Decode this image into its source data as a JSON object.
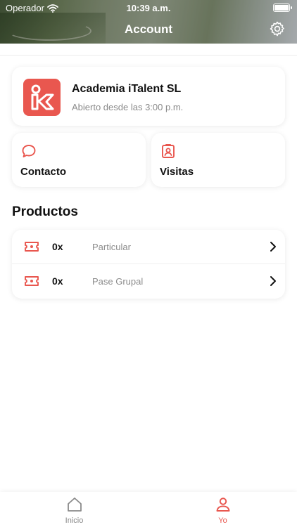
{
  "status_bar": {
    "carrier": "Operador",
    "time": "10:39 a.m."
  },
  "header": {
    "title": "Account",
    "settings_icon": "gear-icon"
  },
  "business": {
    "name": "Academia iTalent SL",
    "status": "Abierto desde las 3:00 p.m.",
    "logo_color": "#e9574f"
  },
  "tiles": {
    "contact": {
      "label": "Contacto",
      "icon": "chat-bubble-icon"
    },
    "visits": {
      "label": "Visitas",
      "icon": "id-badge-icon"
    }
  },
  "products": {
    "title": "Productos",
    "items": [
      {
        "qty": "0x",
        "name": "Particular",
        "icon": "ticket-icon"
      },
      {
        "qty": "0x",
        "name": "Pase Grupal",
        "icon": "ticket-icon"
      }
    ]
  },
  "tabbar": {
    "tabs": [
      {
        "label": "Inicio",
        "icon": "home-icon",
        "active": false
      },
      {
        "label": "Yo",
        "icon": "user-icon",
        "active": true
      }
    ]
  },
  "colors": {
    "accent": "#e9574f",
    "muted_text": "#8a8a8a"
  }
}
